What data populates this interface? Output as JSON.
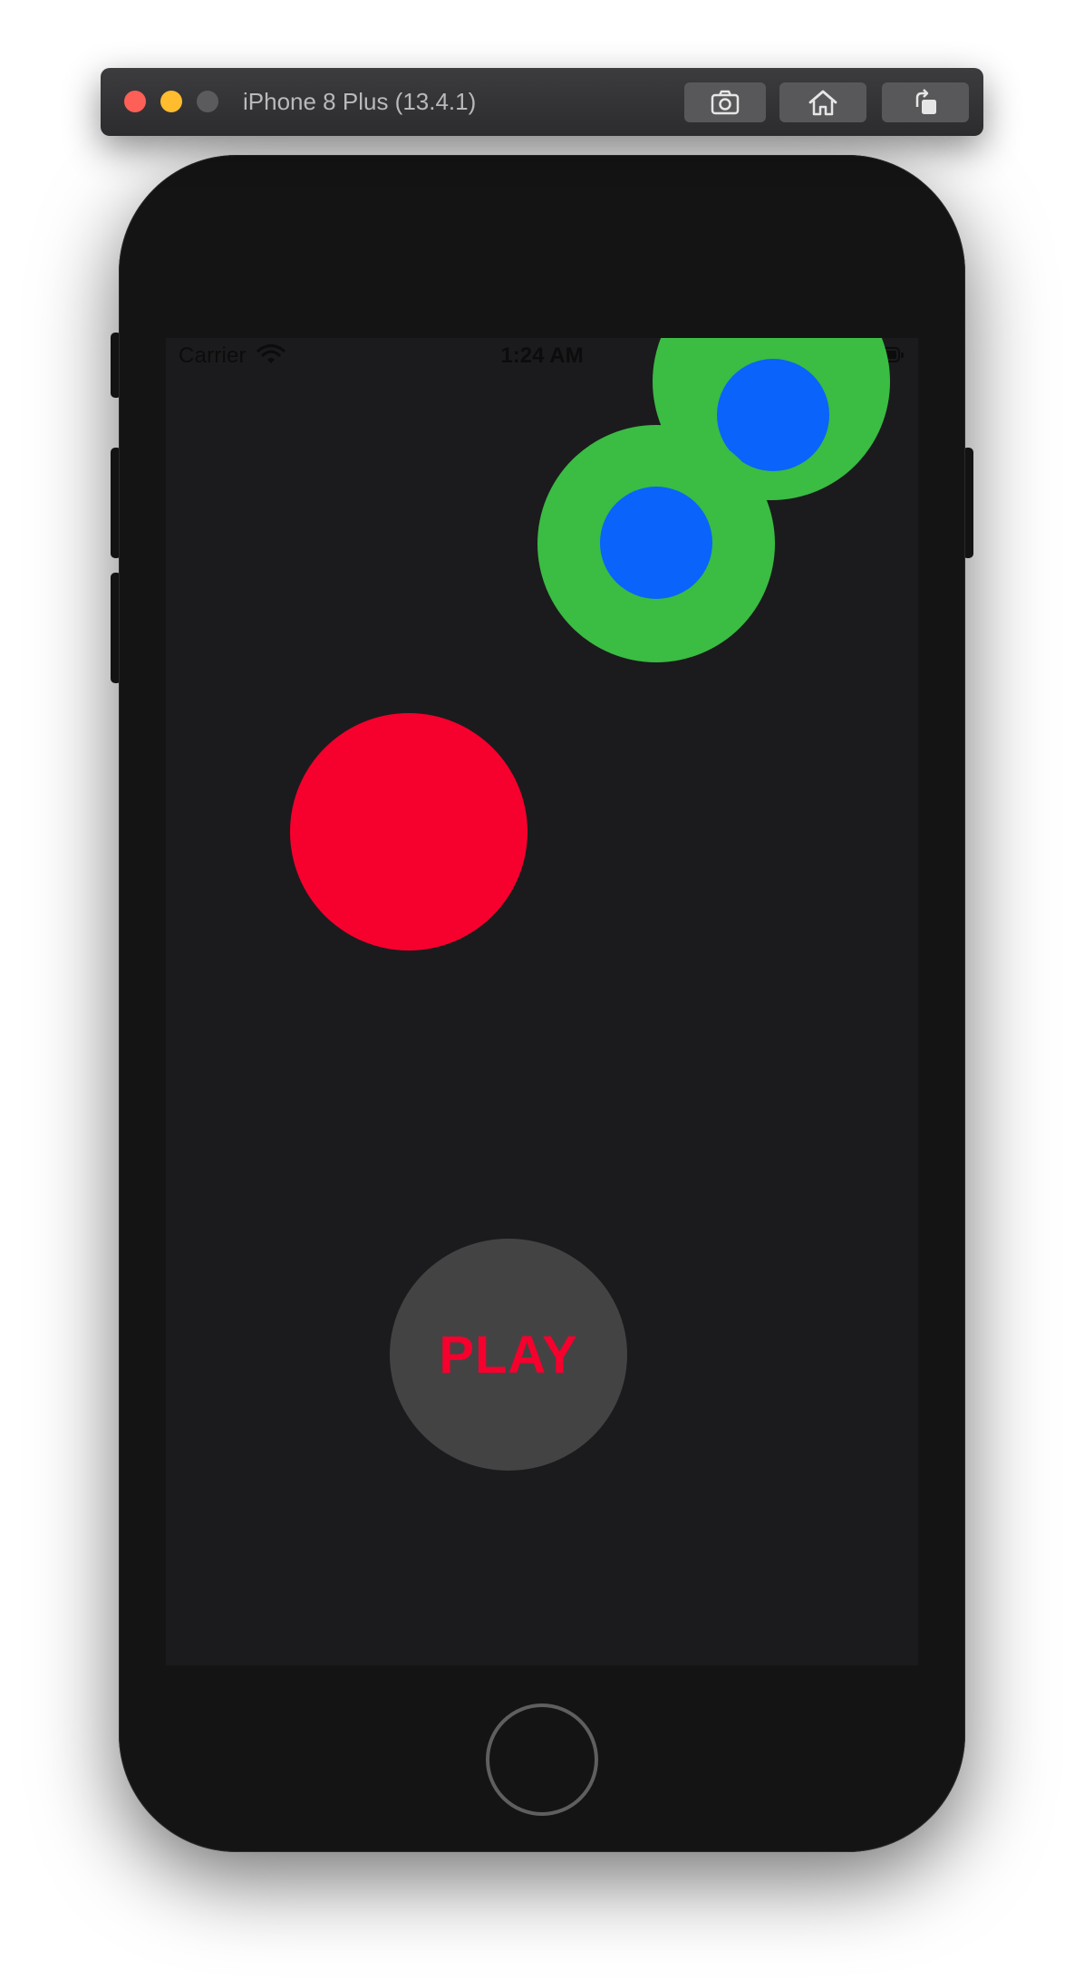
{
  "simulator": {
    "title": "iPhone 8 Plus (13.4.1)",
    "toolbar_buttons": [
      {
        "name": "screenshot",
        "icon": "camera-icon"
      },
      {
        "name": "home",
        "icon": "home-icon"
      },
      {
        "name": "rotate",
        "icon": "rotate-icon"
      }
    ]
  },
  "status_bar": {
    "carrier": "Carrier",
    "time": "1:24 AM",
    "wifi_icon": "wifi-icon",
    "battery_icon": "battery-icon"
  },
  "game": {
    "play_label": "PLAY",
    "colors": {
      "background": "#1b1b1d",
      "green_ring": "#3bbc43",
      "blue_dot": "#0a63fb",
      "red_ball": "#f6002e",
      "play_button_bg": "#434344",
      "play_button_text": "#f6002e"
    }
  }
}
